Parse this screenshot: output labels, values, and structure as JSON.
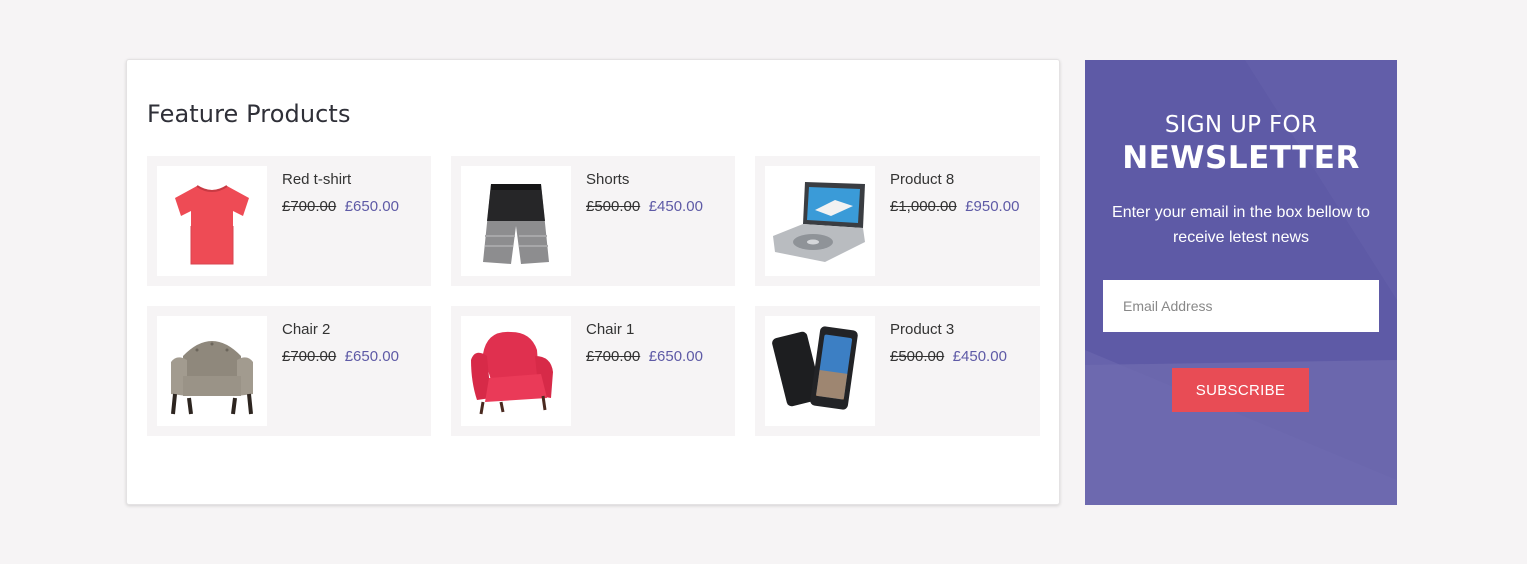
{
  "featured": {
    "title": "Feature Products",
    "products": [
      {
        "name": "Red t-shirt",
        "old_price": "£700.00",
        "new_price": "£650.00",
        "icon": "red-tshirt-image"
      },
      {
        "name": "Shorts",
        "old_price": "£500.00",
        "new_price": "£450.00",
        "icon": "shorts-image"
      },
      {
        "name": "Product 8",
        "old_price": "£1,000.00",
        "new_price": "£950.00",
        "icon": "portable-dvd-player-image"
      },
      {
        "name": "Chair 2",
        "old_price": "£700.00",
        "new_price": "£650.00",
        "icon": "armchair-grey-image"
      },
      {
        "name": "Chair 1",
        "old_price": "£700.00",
        "new_price": "£650.00",
        "icon": "armchair-pink-image"
      },
      {
        "name": "Product 3",
        "old_price": "£500.00",
        "new_price": "£450.00",
        "icon": "smartphones-image"
      }
    ]
  },
  "newsletter": {
    "heading_line1": "SIGN UP FOR",
    "heading_line2": "NEWSLETTER",
    "description": "Enter your email in the box bellow to receive letest news",
    "email_placeholder": "Email Address",
    "subscribe_label": "SUBSCRIBE"
  },
  "colors": {
    "accent_purple": "#5e5aa6",
    "subscribe_red": "#e84c55",
    "page_background": "#f6f4f5"
  }
}
